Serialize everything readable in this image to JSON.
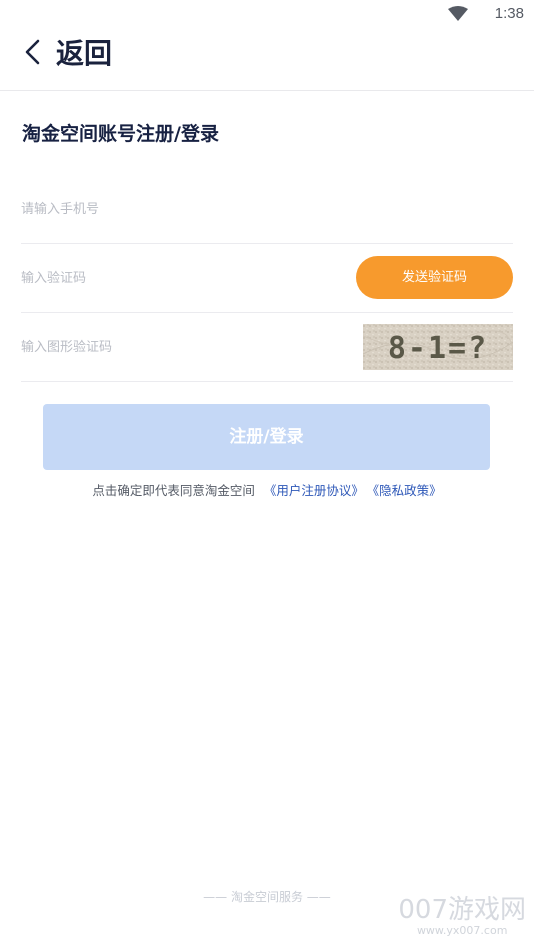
{
  "status_bar": {
    "time": "1:38",
    "wifi_icon": "wifi-icon"
  },
  "nav": {
    "back_icon": "chevron-left-icon",
    "back_label": "返回"
  },
  "page": {
    "title": "淘金空间账号注册/登录"
  },
  "form": {
    "phone_placeholder": "请输入手机号",
    "sms_code_placeholder": "输入验证码",
    "send_code_label": "发送验证码",
    "image_code_placeholder": "输入图形验证码",
    "captcha_text": "8-1=?",
    "submit_label": "注册/登录"
  },
  "agreement": {
    "prefix": "点击确定即代表同意淘金空间",
    "user_agreement_link": "《用户注册协议》",
    "privacy_link": "《隐私政策》"
  },
  "footer": {
    "service_text": "—— 淘金空间服务 ——"
  },
  "watermark": {
    "brand": "007游戏网",
    "url": "www.yx007.com"
  },
  "colors": {
    "accent_orange": "#f79a2d",
    "submit_disabled": "#c5d8f6",
    "link_blue": "#2e58b8",
    "title_dark": "#172142"
  }
}
